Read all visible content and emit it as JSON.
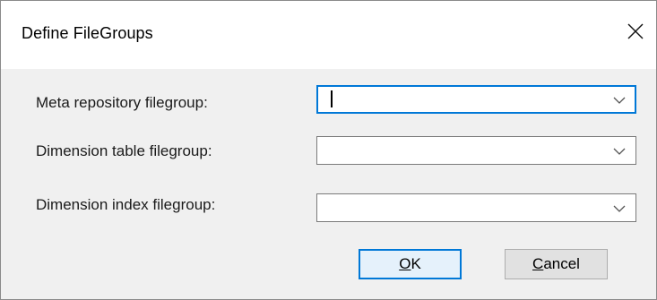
{
  "dialog": {
    "title": "Define FileGroups",
    "close_icon": "close-icon"
  },
  "fields": [
    {
      "label": "Meta repository filegroup:",
      "value": "",
      "focused": true
    },
    {
      "label": "Dimension table filegroup:",
      "value": "",
      "focused": false
    },
    {
      "label": "Dimension index filegroup:",
      "value": "",
      "focused": false
    }
  ],
  "buttons": {
    "ok": {
      "mnemonic": "O",
      "rest": "K"
    },
    "cancel": {
      "mnemonic": "C",
      "rest": "ancel"
    }
  },
  "colors": {
    "focus_accent": "#0078d7",
    "dialog_background": "#f0f0f0",
    "titlebar_background": "#ffffff"
  }
}
